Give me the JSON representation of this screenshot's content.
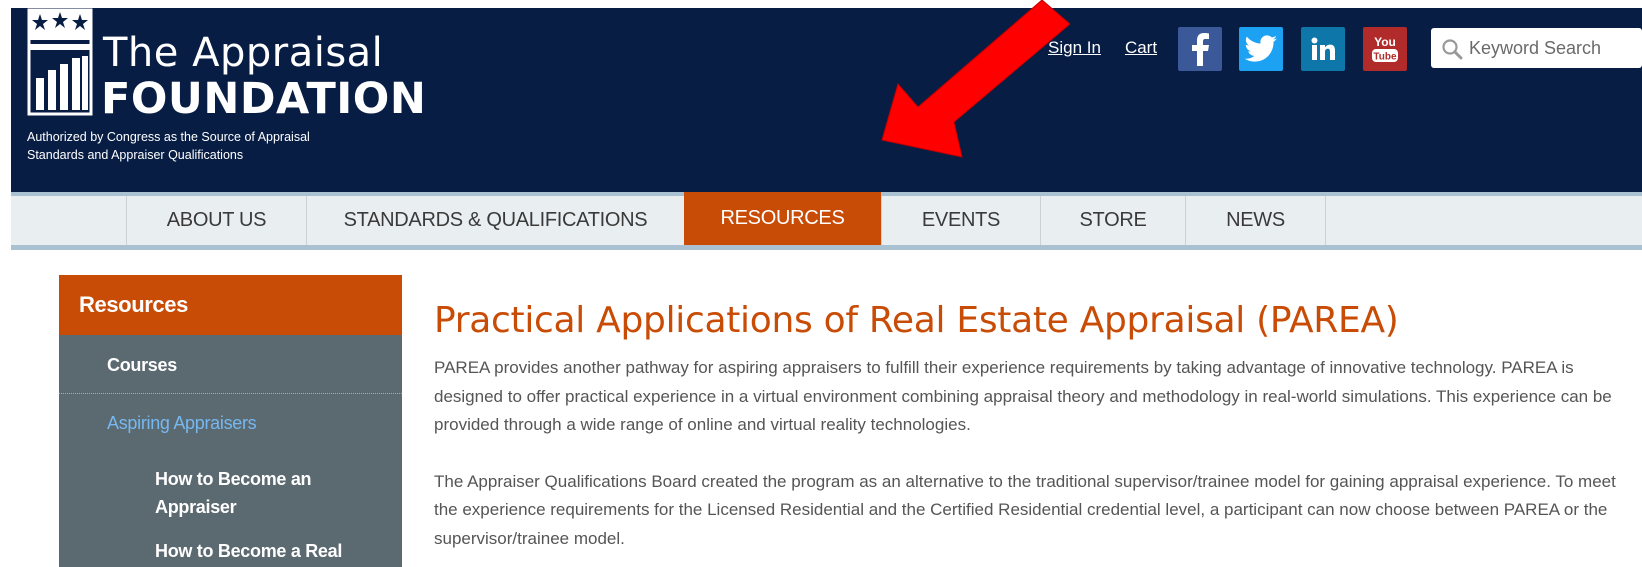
{
  "header": {
    "logo_line1": "The Appraisal",
    "logo_line2": "FOUNDATION",
    "logo_tagline": "Authorized by Congress as the Source of Appraisal Standards and Appraiser Qualifications",
    "sign_in": "Sign In",
    "cart": "Cart",
    "social": [
      {
        "name": "facebook-icon",
        "glyph": "f",
        "color": "#3b5998"
      },
      {
        "name": "twitter-icon",
        "color": "#1da1f2"
      },
      {
        "name": "linkedin-icon",
        "glyph": "in",
        "color": "#0e76a8"
      },
      {
        "name": "youtube-icon",
        "glyph_top": "You",
        "glyph_bottom": "Tube",
        "color": "#b12b2b"
      }
    ],
    "search": {
      "placeholder": "Keyword Search"
    }
  },
  "nav": {
    "items": [
      {
        "label": "ABOUT US"
      },
      {
        "label": "STANDARDS & QUALIFICATIONS"
      },
      {
        "label": "RESOURCES",
        "active": true
      },
      {
        "label": "EVENTS"
      },
      {
        "label": "STORE"
      },
      {
        "label": "NEWS"
      }
    ]
  },
  "sidebar": {
    "heading": "Resources",
    "items": [
      {
        "label": "Courses"
      },
      {
        "label": "Aspiring Appraisers"
      },
      {
        "label": "How to Become an Appraiser"
      },
      {
        "label": "How to Become a Real"
      }
    ]
  },
  "main": {
    "title": "Practical Applications of Real Estate Appraisal (PAREA)",
    "paragraph1": "PAREA provides another pathway for aspiring appraisers to fulfill their experience requirements by taking advantage of innovative technology. PAREA is designed to offer practical experience in a virtual environment combining appraisal theory and methodology in real-world simulations. This experience can be provided through a wide range of online and virtual reality technologies.",
    "paragraph2": "The Appraiser Qualifications Board created the program as an alternative to the traditional supervisor/trainee model for gaining appraisal experience. To meet the experience requirements for the Licensed Residential and the Certified Residential credential level, a participant can now choose between PAREA or the supervisor/trainee model."
  },
  "colors": {
    "header_bg": "#071d44",
    "accent": "#c94c06",
    "sidebar_bg": "#5b6970",
    "nav_bg": "#e9eff0",
    "annotation_arrow": "#ff0000"
  }
}
